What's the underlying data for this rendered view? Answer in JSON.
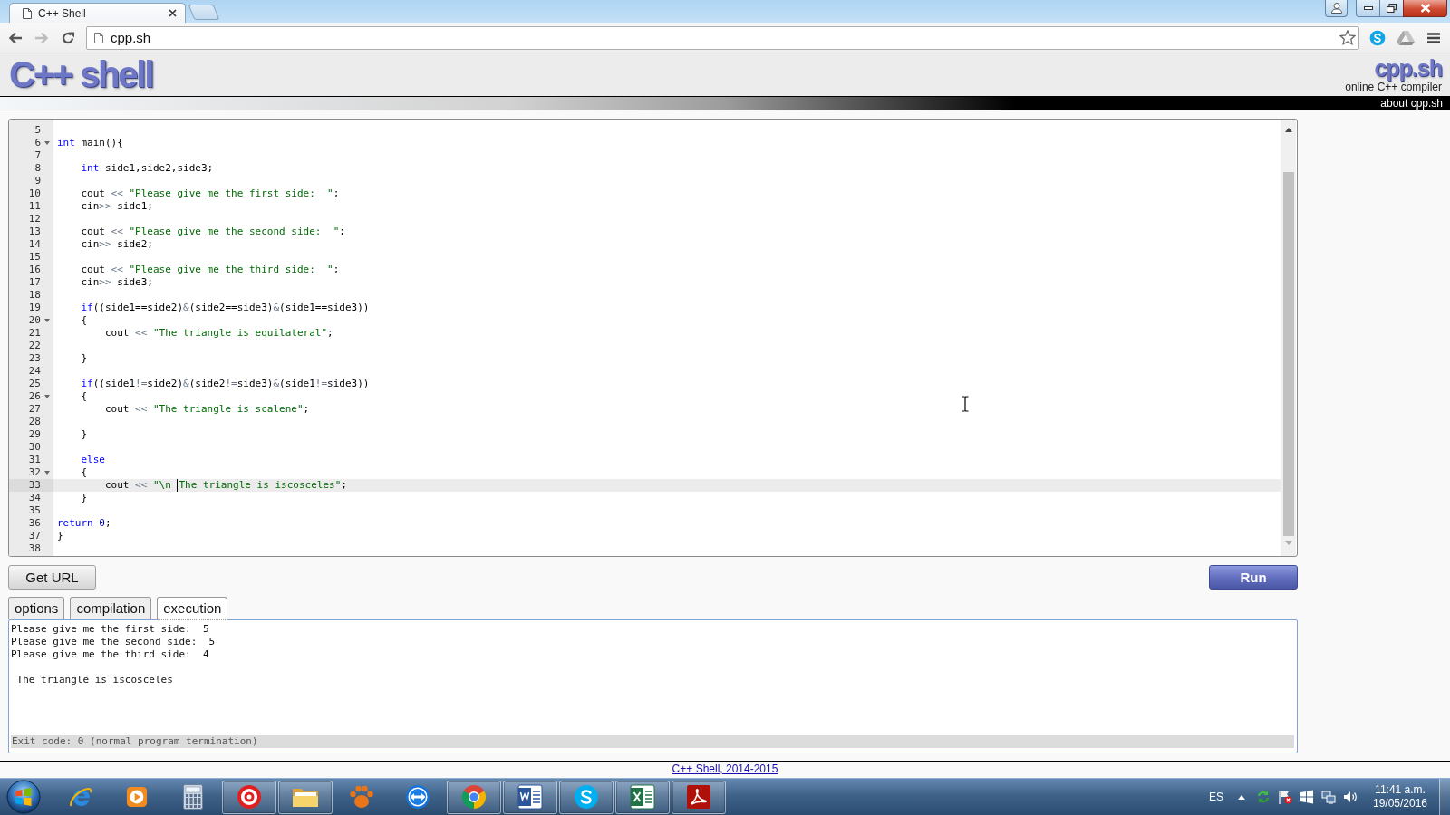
{
  "browser": {
    "tab_title": "C++ Shell",
    "address": "cpp.sh"
  },
  "nav": {
    "back_disabled": false,
    "forward_disabled": true
  },
  "header": {
    "logo": "C++ shell",
    "site": "cpp.sh",
    "tagline": "online C++ compiler",
    "about_link": "about cpp.sh"
  },
  "editor": {
    "lines": [
      {
        "number": "5",
        "fold": false,
        "active": false
      },
      {
        "number": "6",
        "fold": true,
        "active": false,
        "tokens": [
          {
            "kind": "keyword",
            "text": "int"
          },
          {
            "kind": "plain",
            "text": " main(){"
          }
        ]
      },
      {
        "number": "7",
        "fold": false,
        "active": false
      },
      {
        "number": "8",
        "fold": false,
        "active": false,
        "tokens": [
          {
            "kind": "keyword",
            "text": "    int"
          },
          {
            "kind": "plain",
            "text": " side1,side2,side3;"
          }
        ]
      },
      {
        "number": "9",
        "fold": false,
        "active": false
      },
      {
        "number": "10",
        "fold": false,
        "active": false,
        "tokens": [
          {
            "kind": "plain",
            "text": "    cout "
          },
          {
            "kind": "operator",
            "text": "<<"
          },
          {
            "kind": "string",
            "text": " \"Please give me the first side:  \""
          },
          {
            "kind": "plain",
            "text": ";"
          }
        ]
      },
      {
        "number": "11",
        "fold": false,
        "active": false,
        "tokens": [
          {
            "kind": "plain",
            "text": "    cin"
          },
          {
            "kind": "operator",
            "text": ">>"
          },
          {
            "kind": "plain",
            "text": " side1;"
          }
        ]
      },
      {
        "number": "12",
        "fold": false,
        "active": false
      },
      {
        "number": "13",
        "fold": false,
        "active": false,
        "tokens": [
          {
            "kind": "plain",
            "text": "    cout "
          },
          {
            "kind": "operator",
            "text": "<<"
          },
          {
            "kind": "string",
            "text": " \"Please give me the second side:  \""
          },
          {
            "kind": "plain",
            "text": ";"
          }
        ]
      },
      {
        "number": "14",
        "fold": false,
        "active": false,
        "tokens": [
          {
            "kind": "plain",
            "text": "    cin"
          },
          {
            "kind": "operator",
            "text": ">>"
          },
          {
            "kind": "plain",
            "text": " side2;"
          }
        ]
      },
      {
        "number": "15",
        "fold": false,
        "active": false
      },
      {
        "number": "16",
        "fold": false,
        "active": false,
        "tokens": [
          {
            "kind": "plain",
            "text": "    cout "
          },
          {
            "kind": "operator",
            "text": "<<"
          },
          {
            "kind": "string",
            "text": " \"Please give me the third side:  \""
          },
          {
            "kind": "plain",
            "text": ";"
          }
        ]
      },
      {
        "number": "17",
        "fold": false,
        "active": false,
        "tokens": [
          {
            "kind": "plain",
            "text": "    cin"
          },
          {
            "kind": "operator",
            "text": ">>"
          },
          {
            "kind": "plain",
            "text": " side3;"
          }
        ]
      },
      {
        "number": "18",
        "fold": false,
        "active": false
      },
      {
        "number": "19",
        "fold": false,
        "active": false,
        "tokens": [
          {
            "kind": "keyword",
            "text": "    if"
          },
          {
            "kind": "plain",
            "text": "((side1==side2)"
          },
          {
            "kind": "operator",
            "text": "&"
          },
          {
            "kind": "plain",
            "text": "(side2==side3)"
          },
          {
            "kind": "operator",
            "text": "&"
          },
          {
            "kind": "plain",
            "text": "(side1==side3))"
          }
        ]
      },
      {
        "number": "20",
        "fold": true,
        "active": false,
        "tokens": [
          {
            "kind": "plain",
            "text": "    {"
          }
        ]
      },
      {
        "number": "21",
        "fold": false,
        "active": false,
        "tokens": [
          {
            "kind": "plain",
            "text": "        cout "
          },
          {
            "kind": "operator",
            "text": "<<"
          },
          {
            "kind": "string",
            "text": " \"The triangle is equilateral\""
          },
          {
            "kind": "plain",
            "text": ";"
          }
        ]
      },
      {
        "number": "22",
        "fold": false,
        "active": false
      },
      {
        "number": "23",
        "fold": false,
        "active": false,
        "tokens": [
          {
            "kind": "plain",
            "text": "    }"
          }
        ]
      },
      {
        "number": "24",
        "fold": false,
        "active": false
      },
      {
        "number": "25",
        "fold": false,
        "active": false,
        "tokens": [
          {
            "kind": "keyword",
            "text": "    if"
          },
          {
            "kind": "plain",
            "text": "((side1"
          },
          {
            "kind": "operator",
            "text": "!="
          },
          {
            "kind": "plain",
            "text": "side2)"
          },
          {
            "kind": "operator",
            "text": "&"
          },
          {
            "kind": "plain",
            "text": "(side2"
          },
          {
            "kind": "operator",
            "text": "!="
          },
          {
            "kind": "plain",
            "text": "side3)"
          },
          {
            "kind": "operator",
            "text": "&"
          },
          {
            "kind": "plain",
            "text": "(side1"
          },
          {
            "kind": "operator",
            "text": "!="
          },
          {
            "kind": "plain",
            "text": "side3))"
          }
        ]
      },
      {
        "number": "26",
        "fold": true,
        "active": false,
        "tokens": [
          {
            "kind": "plain",
            "text": "    {"
          }
        ]
      },
      {
        "number": "27",
        "fold": false,
        "active": false,
        "tokens": [
          {
            "kind": "plain",
            "text": "        cout "
          },
          {
            "kind": "operator",
            "text": "<<"
          },
          {
            "kind": "string",
            "text": " \"The triangle is scalene\""
          },
          {
            "kind": "plain",
            "text": ";"
          }
        ]
      },
      {
        "number": "28",
        "fold": false,
        "active": false
      },
      {
        "number": "29",
        "fold": false,
        "active": false,
        "tokens": [
          {
            "kind": "plain",
            "text": "    }"
          }
        ]
      },
      {
        "number": "30",
        "fold": false,
        "active": false
      },
      {
        "number": "31",
        "fold": false,
        "active": false,
        "tokens": [
          {
            "kind": "keyword",
            "text": "    else"
          }
        ]
      },
      {
        "number": "32",
        "fold": true,
        "active": false,
        "tokens": [
          {
            "kind": "plain",
            "text": "    {"
          }
        ]
      },
      {
        "number": "33",
        "fold": false,
        "active": true,
        "tokens": [
          {
            "kind": "plain",
            "text": "        cout "
          },
          {
            "kind": "operator",
            "text": "<<"
          },
          {
            "kind": "string",
            "text": " \"\\n "
          },
          {
            "kind": "caret"
          },
          {
            "kind": "string",
            "text": "The triangle is iscosceles\""
          },
          {
            "kind": "plain",
            "text": ";"
          }
        ]
      },
      {
        "number": "34",
        "fold": false,
        "active": false,
        "tokens": [
          {
            "kind": "plain",
            "text": "    }"
          }
        ]
      },
      {
        "number": "35",
        "fold": false,
        "active": false
      },
      {
        "number": "36",
        "fold": false,
        "active": false,
        "tokens": [
          {
            "kind": "keyword",
            "text": "return"
          },
          {
            "kind": "number",
            "text": " 0"
          },
          {
            "kind": "plain",
            "text": ";"
          }
        ]
      },
      {
        "number": "37",
        "fold": false,
        "active": false,
        "tokens": [
          {
            "kind": "plain",
            "text": "}"
          }
        ]
      },
      {
        "number": "38",
        "fold": false,
        "active": false
      }
    ]
  },
  "buttons": {
    "get_url": "Get URL",
    "run": "Run"
  },
  "output_tabs": [
    {
      "label": "options",
      "selected": false
    },
    {
      "label": "compilation",
      "selected": false
    },
    {
      "label": "execution",
      "selected": true
    }
  ],
  "output": {
    "text": "Please give me the first side:  5\nPlease give me the second side:  5\nPlease give me the third side:  4\n\n The triangle is iscosceles",
    "exit_status": "Exit code: 0 (normal program termination)"
  },
  "footer": {
    "link": "C++ Shell, 2014-2015"
  },
  "taskbar": {
    "apps": [
      {
        "running": false
      },
      {
        "running": false
      },
      {
        "running": false
      },
      {
        "running": true
      },
      {
        "running": true
      },
      {
        "running": false
      },
      {
        "running": false
      },
      {
        "running": true
      },
      {
        "running": true
      },
      {
        "running": true
      },
      {
        "running": true
      },
      {
        "running": true
      }
    ],
    "language": "ES",
    "time": "11:41 a.m.",
    "date": "19/05/2016"
  }
}
